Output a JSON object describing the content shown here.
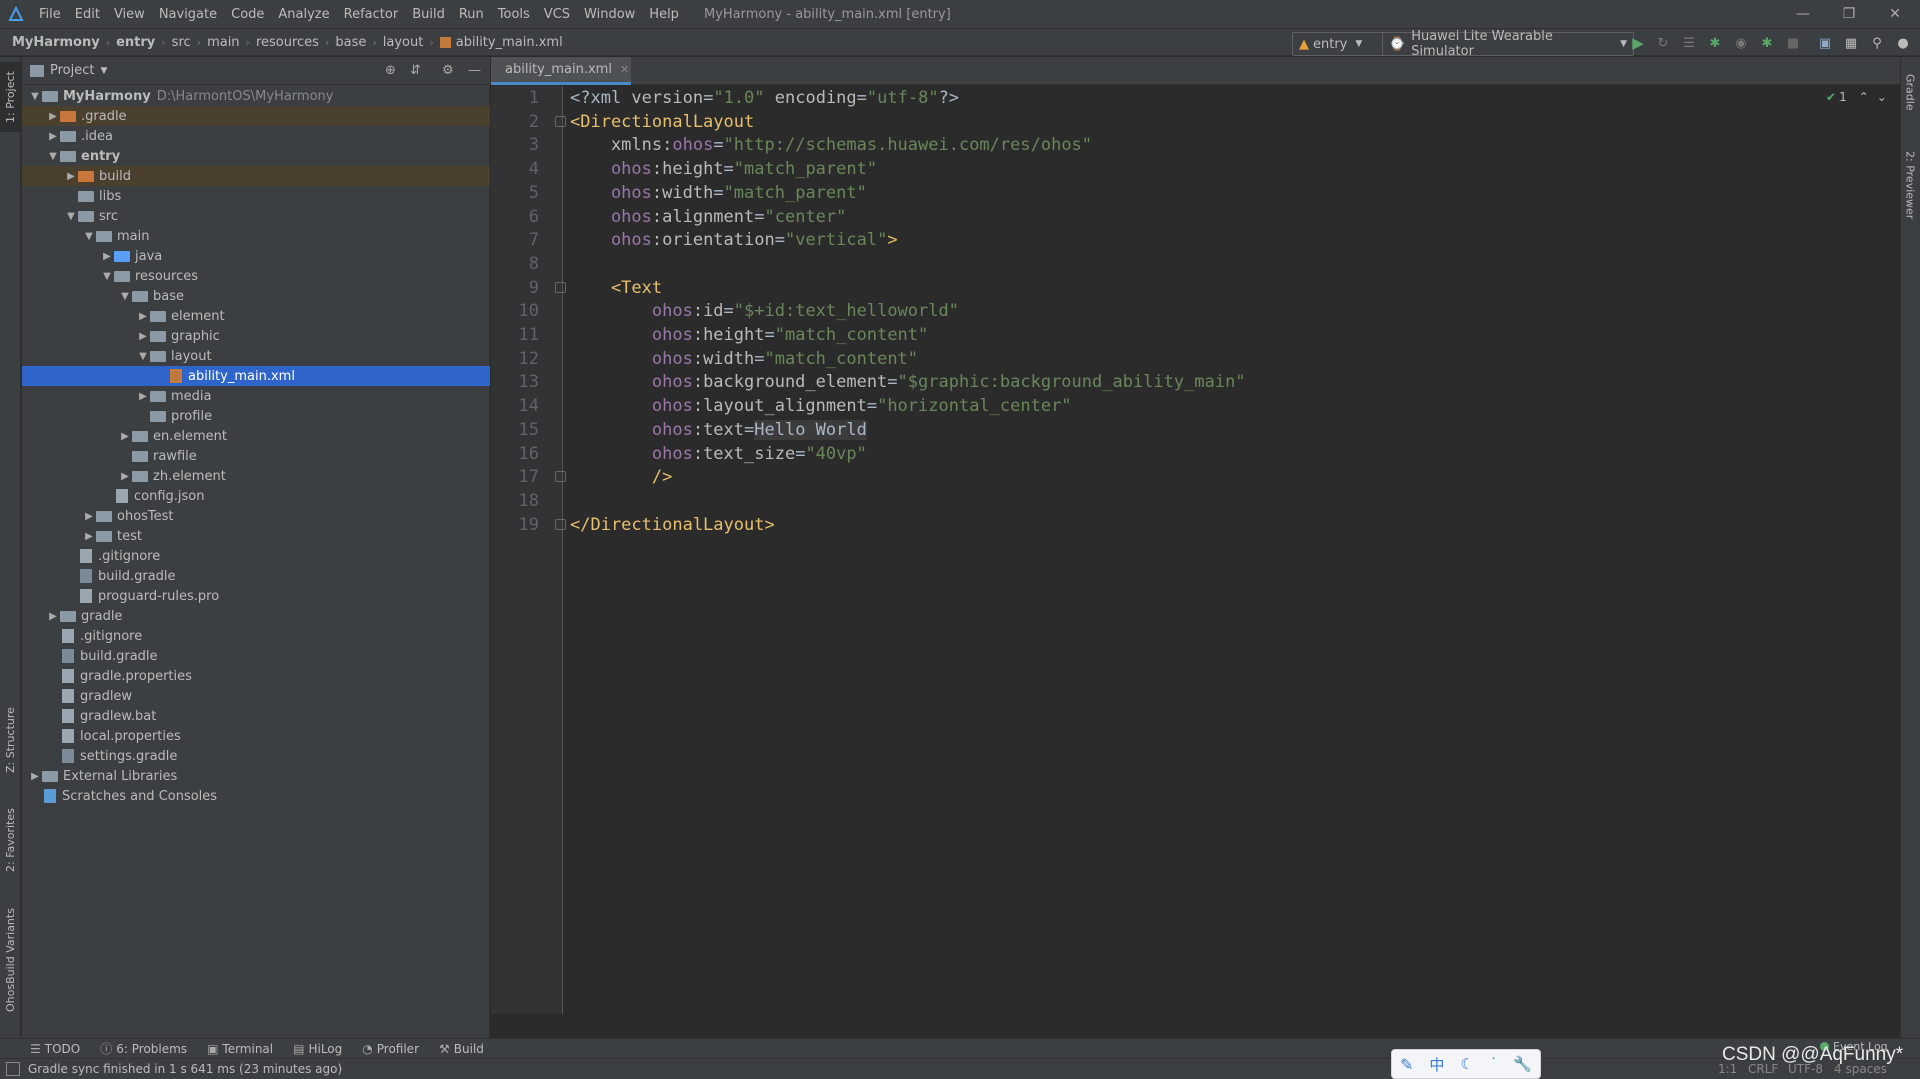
{
  "menubar": {
    "items": [
      "File",
      "Edit",
      "View",
      "Navigate",
      "Code",
      "Analyze",
      "Refactor",
      "Build",
      "Run",
      "Tools",
      "VCS",
      "Window",
      "Help"
    ],
    "window_title": "MyHarmony - ability_main.xml [entry]"
  },
  "breadcrumb": [
    "MyHarmony",
    "entry",
    "src",
    "main",
    "resources",
    "base",
    "layout",
    "ability_main.xml"
  ],
  "toolbar": {
    "module_combo": "entry",
    "device_combo": "Huawei Lite Wearable Simulator"
  },
  "project_panel": {
    "title": "Project",
    "root_name": "MyHarmony",
    "root_path": "D:\\HarmontOS\\MyHarmony",
    "tree": [
      {
        "label": ".gradle",
        "indent": 1,
        "arrow": "right",
        "icon": "folder-orange",
        "ignored": true
      },
      {
        "label": ".idea",
        "indent": 1,
        "arrow": "right",
        "icon": "folder"
      },
      {
        "label": "entry",
        "indent": 1,
        "arrow": "down",
        "icon": "folder-module",
        "bold": true
      },
      {
        "label": "build",
        "indent": 2,
        "arrow": "right",
        "icon": "folder-orange",
        "ignored": true
      },
      {
        "label": "libs",
        "indent": 2,
        "arrow": "",
        "icon": "folder"
      },
      {
        "label": "src",
        "indent": 2,
        "arrow": "down",
        "icon": "folder"
      },
      {
        "label": "main",
        "indent": 3,
        "arrow": "down",
        "icon": "folder"
      },
      {
        "label": "java",
        "indent": 4,
        "arrow": "right",
        "icon": "folder-blue"
      },
      {
        "label": "resources",
        "indent": 4,
        "arrow": "down",
        "icon": "folder-res"
      },
      {
        "label": "base",
        "indent": 5,
        "arrow": "down",
        "icon": "folder"
      },
      {
        "label": "element",
        "indent": 6,
        "arrow": "right",
        "icon": "folder"
      },
      {
        "label": "graphic",
        "indent": 6,
        "arrow": "right",
        "icon": "folder"
      },
      {
        "label": "layout",
        "indent": 6,
        "arrow": "down",
        "icon": "folder"
      },
      {
        "label": "ability_main.xml",
        "indent": 7,
        "arrow": "",
        "icon": "xml-file",
        "selected": true
      },
      {
        "label": "media",
        "indent": 6,
        "arrow": "right",
        "icon": "folder"
      },
      {
        "label": "profile",
        "indent": 6,
        "arrow": "",
        "icon": "folder"
      },
      {
        "label": "en.element",
        "indent": 5,
        "arrow": "right",
        "icon": "folder"
      },
      {
        "label": "rawfile",
        "indent": 5,
        "arrow": "",
        "icon": "folder"
      },
      {
        "label": "zh.element",
        "indent": 5,
        "arrow": "right",
        "icon": "folder"
      },
      {
        "label": "config.json",
        "indent": 4,
        "arrow": "",
        "icon": "json-file"
      },
      {
        "label": "ohosTest",
        "indent": 3,
        "arrow": "right",
        "icon": "folder"
      },
      {
        "label": "test",
        "indent": 3,
        "arrow": "right",
        "icon": "folder"
      },
      {
        "label": ".gitignore",
        "indent": 2,
        "arrow": "",
        "icon": "text-file"
      },
      {
        "label": "build.gradle",
        "indent": 2,
        "arrow": "",
        "icon": "gradle-file"
      },
      {
        "label": "proguard-rules.pro",
        "indent": 2,
        "arrow": "",
        "icon": "text-file"
      },
      {
        "label": "gradle",
        "indent": 1,
        "arrow": "right",
        "icon": "folder"
      },
      {
        "label": ".gitignore",
        "indent": 1,
        "arrow": "",
        "icon": "text-file"
      },
      {
        "label": "build.gradle",
        "indent": 1,
        "arrow": "",
        "icon": "gradle-file"
      },
      {
        "label": "gradle.properties",
        "indent": 1,
        "arrow": "",
        "icon": "properties-file"
      },
      {
        "label": "gradlew",
        "indent": 1,
        "arrow": "",
        "icon": "script-file"
      },
      {
        "label": "gradlew.bat",
        "indent": 1,
        "arrow": "",
        "icon": "script-file"
      },
      {
        "label": "local.properties",
        "indent": 1,
        "arrow": "",
        "icon": "properties-file"
      },
      {
        "label": "settings.gradle",
        "indent": 1,
        "arrow": "",
        "icon": "gradle-file"
      },
      {
        "label": "External Libraries",
        "indent": 0,
        "arrow": "right",
        "icon": "library"
      },
      {
        "label": "Scratches and Consoles",
        "indent": 0,
        "arrow": "",
        "icon": "scratches"
      }
    ]
  },
  "editor": {
    "tab_label": "ability_main.xml",
    "inspection_count": "1",
    "lines": [
      [
        [
          "pi",
          "<?xml "
        ],
        [
          "attr",
          "version"
        ],
        [
          "pi",
          "="
        ],
        [
          "val",
          "\"1.0\""
        ],
        [
          "pi",
          " "
        ],
        [
          "attr",
          "encoding"
        ],
        [
          "pi",
          "="
        ],
        [
          "val",
          "\"utf-8\""
        ],
        [
          "pi",
          "?>"
        ]
      ],
      [
        [
          "tag",
          "<DirectionalLayout"
        ]
      ],
      [
        [
          "attr",
          "    xmlns:"
        ],
        [
          "ns",
          "ohos"
        ],
        [
          "pi",
          "="
        ],
        [
          "val",
          "\"http://schemas.huawei.com/res/ohos\""
        ]
      ],
      [
        [
          "ns",
          "    ohos"
        ],
        [
          "attr",
          ":height"
        ],
        [
          "pi",
          "="
        ],
        [
          "val",
          "\"match_parent\""
        ]
      ],
      [
        [
          "ns",
          "    ohos"
        ],
        [
          "attr",
          ":width"
        ],
        [
          "pi",
          "="
        ],
        [
          "val",
          "\"match_parent\""
        ]
      ],
      [
        [
          "ns",
          "    ohos"
        ],
        [
          "attr",
          ":alignment"
        ],
        [
          "pi",
          "="
        ],
        [
          "val",
          "\"center\""
        ]
      ],
      [
        [
          "ns",
          "    ohos"
        ],
        [
          "attr",
          ":orientation"
        ],
        [
          "pi",
          "="
        ],
        [
          "val",
          "\"vertical\""
        ],
        [
          "tag",
          ">"
        ]
      ],
      [],
      [
        [
          "tag",
          "    <Text"
        ]
      ],
      [
        [
          "ns",
          "        ohos"
        ],
        [
          "attr",
          ":id"
        ],
        [
          "pi",
          "="
        ],
        [
          "val",
          "\"$+id:text_helloworld\""
        ]
      ],
      [
        [
          "ns",
          "        ohos"
        ],
        [
          "attr",
          ":height"
        ],
        [
          "pi",
          "="
        ],
        [
          "val",
          "\"match_content\""
        ]
      ],
      [
        [
          "ns",
          "        ohos"
        ],
        [
          "attr",
          ":width"
        ],
        [
          "pi",
          "="
        ],
        [
          "val",
          "\"match_content\""
        ]
      ],
      [
        [
          "ns",
          "        ohos"
        ],
        [
          "attr",
          ":background_element"
        ],
        [
          "pi",
          "="
        ],
        [
          "val",
          "\"$graphic:background_ability_main\""
        ]
      ],
      [
        [
          "ns",
          "        ohos"
        ],
        [
          "attr",
          ":layout_alignment"
        ],
        [
          "pi",
          "="
        ],
        [
          "val",
          "\"horizontal_center\""
        ]
      ],
      [
        [
          "ns",
          "        ohos"
        ],
        [
          "attr",
          ":text"
        ],
        [
          "pi",
          "="
        ],
        [
          "hl",
          "Hello World"
        ]
      ],
      [
        [
          "ns",
          "        ohos"
        ],
        [
          "attr",
          ":text_size"
        ],
        [
          "pi",
          "="
        ],
        [
          "val",
          "\"40vp\""
        ]
      ],
      [
        [
          "tag",
          "        />"
        ]
      ],
      [],
      [
        [
          "tag",
          "</DirectionalLayout>"
        ]
      ]
    ]
  },
  "left_strip": {
    "project_tab": "1: Project",
    "structure_tab": "Z: Structure",
    "favorites_tab": "2: Favorites",
    "build_variants_tab": "OhosBuild Variants"
  },
  "right_strip": {
    "gradle_tab": "Gradle",
    "previewer_tab": "2: Previewer"
  },
  "bottom_tools": [
    "TODO",
    "6: Problems",
    "Terminal",
    "HiLog",
    "Profiler",
    "Build"
  ],
  "status": {
    "message": "Gradle sync finished in 1 s 641 ms (23 minutes ago)",
    "event_log": "Event Log",
    "position": "1:1",
    "line_sep": "CRLF",
    "encoding": "UTF-8",
    "indent": "4 spaces",
    "watermark": "CSDN @@AqFunny*"
  },
  "ime": {
    "lang": "中"
  }
}
